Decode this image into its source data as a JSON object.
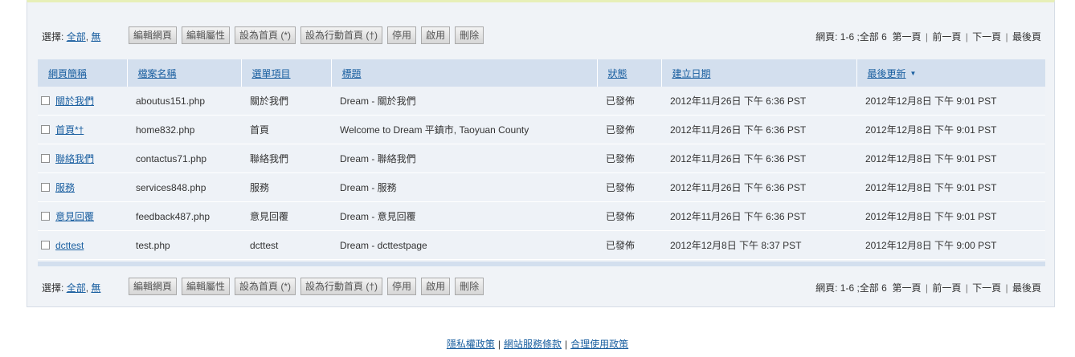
{
  "toolbar": {
    "select_label": "選擇:",
    "select_all": "全部",
    "select_none": "無",
    "separator": ",",
    "buttons": [
      "編輯網頁",
      "編輯屬性",
      "設為首頁 (*)",
      "設為行動首頁 (†)",
      "停用",
      "啟用",
      "刪除"
    ],
    "pager": {
      "pages_label": "網頁: 1-6 ;全部 6",
      "first": "第一頁",
      "prev": "前一頁",
      "next": "下一頁",
      "last": "最後頁",
      "sep": "|"
    }
  },
  "table": {
    "headers": [
      "網頁簡稱",
      "檔案名稱",
      "選單項目",
      "標題",
      "狀態",
      "建立日期",
      "最後更新"
    ],
    "sort_icon": "chevron-down-icon",
    "rows": [
      {
        "short": "關於我們",
        "file": "aboutus151.php",
        "menu": "關於我們",
        "title": "Dream - 關於我們",
        "status": "已發佈",
        "created": "2012年11月26日 下午 6:36 PST",
        "updated": "2012年12月8日 下午 9:01 PST"
      },
      {
        "short": "首頁*†",
        "file": "home832.php",
        "menu": "首頁",
        "title": "Welcome to Dream 平鎮市, Taoyuan County",
        "status": "已發佈",
        "created": "2012年11月26日 下午 6:36 PST",
        "updated": "2012年12月8日 下午 9:01 PST"
      },
      {
        "short": "聯絡我們",
        "file": "contactus71.php",
        "menu": "聯絡我們",
        "title": "Dream - 聯絡我們",
        "status": "已發佈",
        "created": "2012年11月26日 下午 6:36 PST",
        "updated": "2012年12月8日 下午 9:01 PST"
      },
      {
        "short": "服務",
        "file": "services848.php",
        "menu": "服務",
        "title": "Dream - 服務",
        "status": "已發佈",
        "created": "2012年11月26日 下午 6:36 PST",
        "updated": "2012年12月8日 下午 9:01 PST"
      },
      {
        "short": "意見回覆",
        "file": "feedback487.php",
        "menu": "意見回覆",
        "title": "Dream - 意見回覆",
        "status": "已發佈",
        "created": "2012年11月26日 下午 6:36 PST",
        "updated": "2012年12月8日 下午 9:01 PST"
      },
      {
        "short": "dcttest",
        "file": "test.php",
        "menu": "dcttest",
        "title": "Dream - dcttestpage",
        "status": "已發佈",
        "created": "2012年12月8日 下午 8:37 PST",
        "updated": "2012年12月8日 下午 9:00 PST"
      }
    ]
  },
  "footer": {
    "links": [
      "隱私權政策",
      "網站服務條款",
      "合理使用政策"
    ],
    "sep": "|"
  },
  "colors": {
    "link": "#1a5fa0",
    "header_bg": "#d3dfee",
    "panel_bg": "#f0f3f7"
  }
}
